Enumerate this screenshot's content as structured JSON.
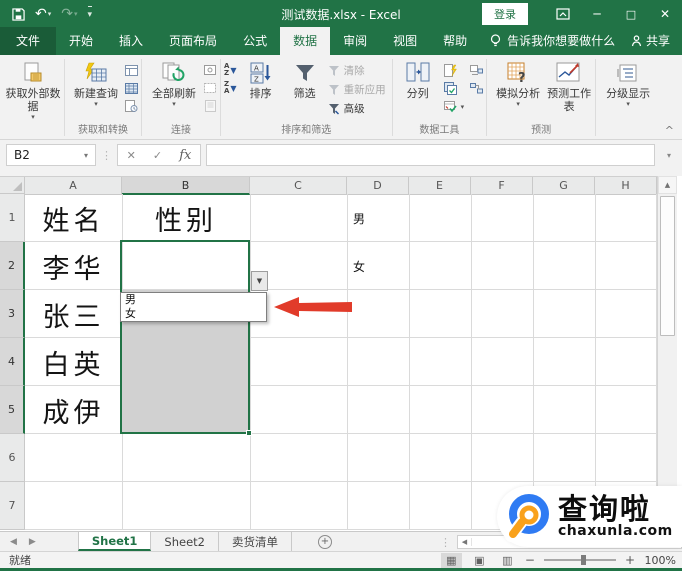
{
  "colors": {
    "excel_green": "#217346",
    "arrow_red": "#e13b2a",
    "logo_blue": "#2f7bf3",
    "logo_orange": "#f9a11b",
    "selection_gray": "#d1d1d1"
  },
  "icons": {
    "caret": "▾",
    "up": "▲",
    "down": "▼",
    "left": "◀",
    "right": "▶",
    "check": "✓",
    "cancel": "✕",
    "fx": "fx",
    "minimize": "─",
    "maximize": "□",
    "close": "✕",
    "undo": "↶",
    "redo": "↷",
    "dots": "⋮",
    "add": "+",
    "collapse": "^",
    "minus": "−",
    "plus": "+",
    "refresh": "⟳",
    "view_normal": "▦",
    "view_layout": "▣",
    "view_break": "▥",
    "sort_a": "A",
    "sort_z": "Z"
  },
  "titlebar": {
    "title": "测试数据.xlsx - Excel",
    "login": "登录"
  },
  "tabs": {
    "items": [
      "文件",
      "开始",
      "插入",
      "页面布局",
      "公式",
      "数据",
      "审阅",
      "视图",
      "帮助"
    ],
    "active": "数据",
    "tell_me": "告诉我你想要做什么",
    "share": "共享"
  },
  "ribbon": {
    "get_external": "获取外部数据",
    "new_query": "新建查询",
    "refresh_all": "全部刷新",
    "sort": "排序",
    "filter": "筛选",
    "clear": "清除",
    "reapply": "重新应用",
    "advanced": "高级",
    "split_columns": "分列",
    "what_if": "模拟分析",
    "forecast_sheet": "预测工作表",
    "outline": "分级显示",
    "labels": {
      "get_transform": "获取和转换",
      "connections": "连接",
      "sort_filter": "排序和筛选",
      "data_tools": "数据工具",
      "forecast": "预测"
    }
  },
  "formula_bar": {
    "name_box": "B2",
    "formula": ""
  },
  "sheet": {
    "columns": [
      "A",
      "B",
      "C",
      "D",
      "E",
      "F",
      "G",
      "H"
    ],
    "rows": [
      "1",
      "2",
      "3",
      "4",
      "5",
      "6",
      "7"
    ],
    "cells": {
      "a1": "姓名",
      "b1": "性别",
      "d1": "男",
      "a2": "李华",
      "d2": "女",
      "a3": "张三",
      "a4": "白英",
      "a5": "成伊"
    },
    "dropdown_items": [
      "男",
      "女"
    ]
  },
  "sheet_tabs": {
    "items": [
      "Sheet1",
      "Sheet2",
      "卖货清单"
    ],
    "active": "Sheet1"
  },
  "status_bar": {
    "mode": "就绪",
    "zoom": "100%"
  },
  "watermark": {
    "name": "查询啦",
    "domain": "chaxunla.com"
  }
}
